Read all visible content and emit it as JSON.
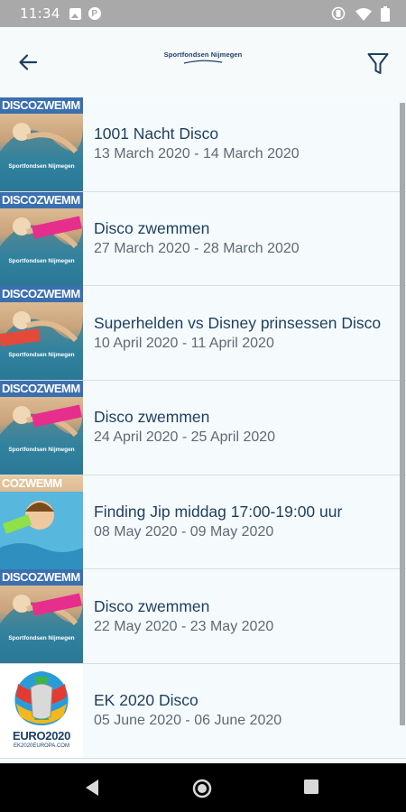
{
  "status_bar": {
    "time": "11:34",
    "icons": [
      "image-notification-icon",
      "p-notification-icon",
      "vibrate-icon",
      "wifi-icon",
      "battery-icon"
    ]
  },
  "app_bar": {
    "logo_text": "Sportfondsen Nijmegen",
    "back_icon": "arrow-left-icon",
    "filter_icon": "filter-icon"
  },
  "colors": {
    "title": "#1e3e5e",
    "date": "#5f6a72",
    "list_background": "#f5fbfc",
    "divider": "#d6dde0"
  },
  "events": [
    {
      "title": "1001 Nacht Disco",
      "date": "13 March 2020 - 14 March 2020",
      "thumb_caption": "DISCOZWEMM",
      "thumb_kind": "disco"
    },
    {
      "title": "Disco zwemmen",
      "date": "27 March 2020 - 28 March 2020",
      "thumb_caption": "DISCOZWEMM",
      "thumb_kind": "disco-pink"
    },
    {
      "title": "Superhelden vs Disney prinsessen Disco",
      "date": "10 April 2020 - 11 April 2020",
      "thumb_caption": "DISCOZWEMM",
      "thumb_kind": "disco-heroes"
    },
    {
      "title": "Disco zwemmen",
      "date": "24 April 2020 - 25 April 2020",
      "thumb_caption": "DISCOZWEMM",
      "thumb_kind": "disco-pink"
    },
    {
      "title": "Finding Jip middag 17:00-19:00 uur",
      "date": "08 May 2020 - 09 May 2020",
      "thumb_caption": "COZWEMM",
      "thumb_kind": "pool"
    },
    {
      "title": "Disco zwemmen",
      "date": "22 May 2020 - 23 May 2020",
      "thumb_caption": "DISCOZWEMM",
      "thumb_kind": "disco-pink"
    },
    {
      "title": "EK 2020 Disco",
      "date": "05 June 2020 - 06 June 2020",
      "thumb_caption": "EURO2020",
      "thumb_subcaption": "EK2020EUROPA.COM",
      "thumb_kind": "euro"
    }
  ]
}
